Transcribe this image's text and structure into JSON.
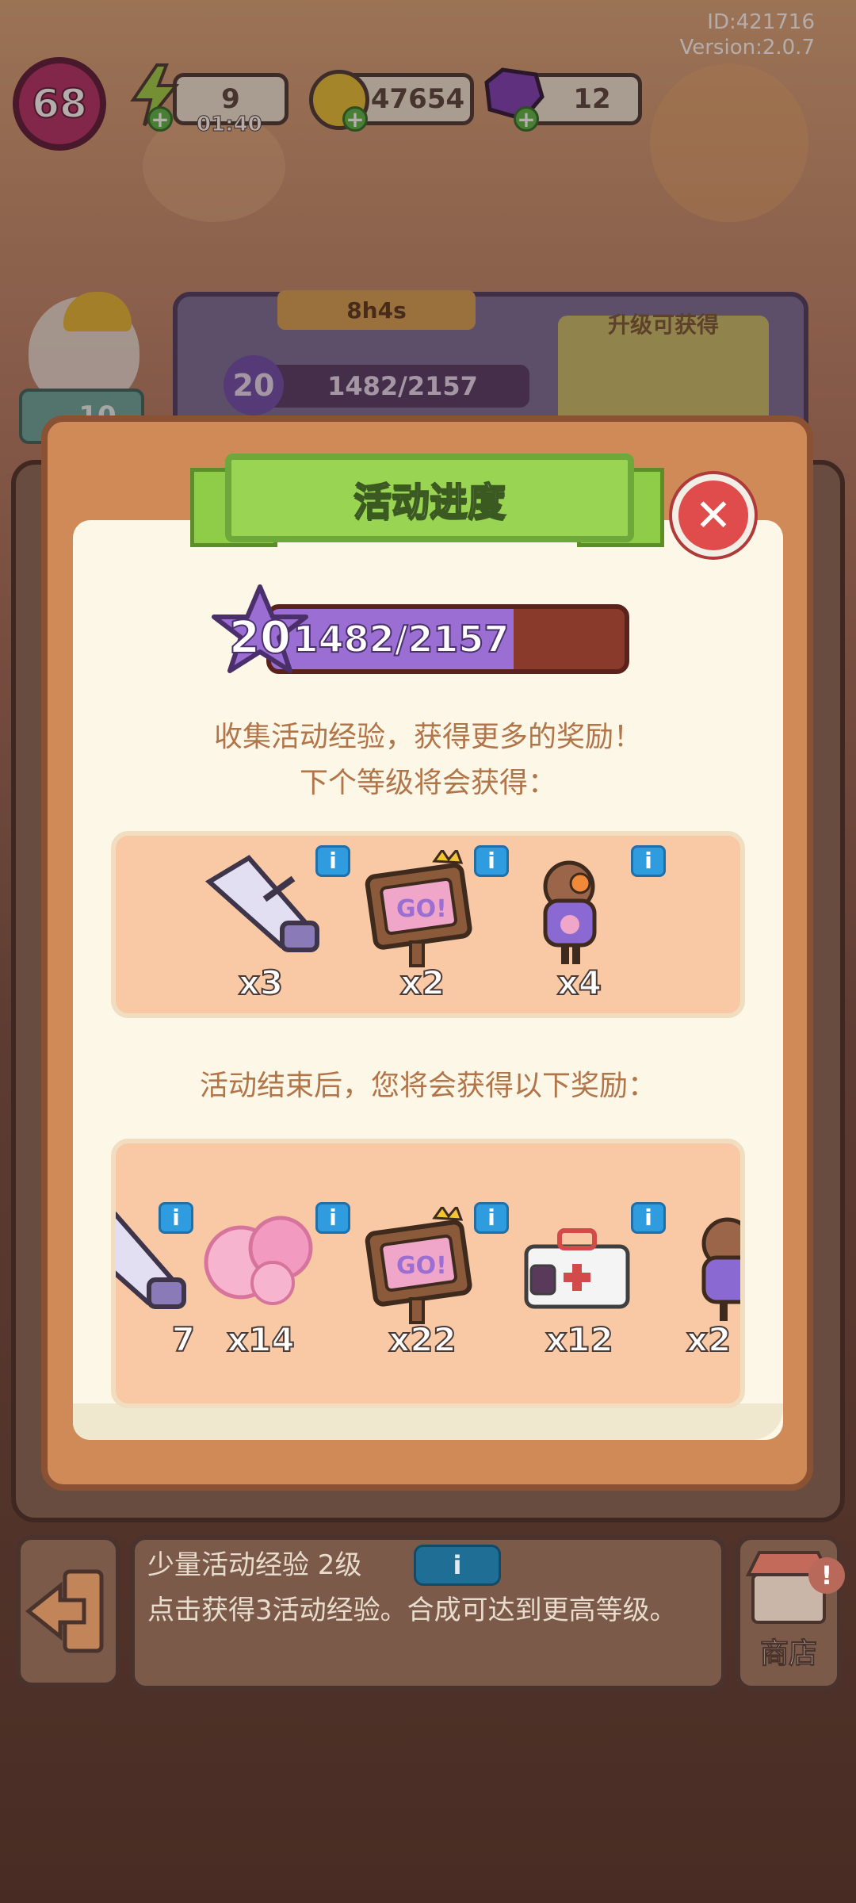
{
  "top": {
    "id": "ID:421716",
    "version": "Version:2.0.7"
  },
  "hud": {
    "level": "68",
    "energy": "9",
    "energy_timer": "01:40",
    "coins": "47654",
    "gems": "12"
  },
  "event_panel": {
    "timer": "8h4s",
    "upgrade_title": "升级可获得",
    "level": "20",
    "progress": "1482/2157",
    "helper_count": "10"
  },
  "modal": {
    "title": "活动进度",
    "level": "20",
    "progress_text": "1482/2157",
    "progress_value": 1482,
    "progress_max": 2157,
    "desc_line1": "收集活动经验，获得更多的奖励！",
    "desc_line2": "下个等级将会获得：",
    "next_level_rewards": [
      {
        "icon": "megaphone-icon",
        "qty": "x3"
      },
      {
        "icon": "go-sign-icon",
        "qty": "x2"
      },
      {
        "icon": "basketball-player-icon",
        "qty": "x4"
      }
    ],
    "end_label": "活动结束后，您将会获得以下奖励：",
    "end_rewards": [
      {
        "icon": "megaphone-icon",
        "qty": "7"
      },
      {
        "icon": "pom-pom-icon",
        "qty": "x14"
      },
      {
        "icon": "go-sign-icon",
        "qty": "x22"
      },
      {
        "icon": "first-aid-kit-icon",
        "qty": "x12"
      },
      {
        "icon": "basketball-player-icon",
        "qty": "x2"
      }
    ]
  },
  "bottom": {
    "item_title": "少量活动经验 2级",
    "item_desc": "点击获得3活动经验。合成可达到更高等级。",
    "shop_label": "商店"
  },
  "colors": {
    "ribbon_green": "#9ad453",
    "progress_purple": "#9a6ed2",
    "close_red": "#e04c4c",
    "info_blue": "#2f9ce0"
  }
}
